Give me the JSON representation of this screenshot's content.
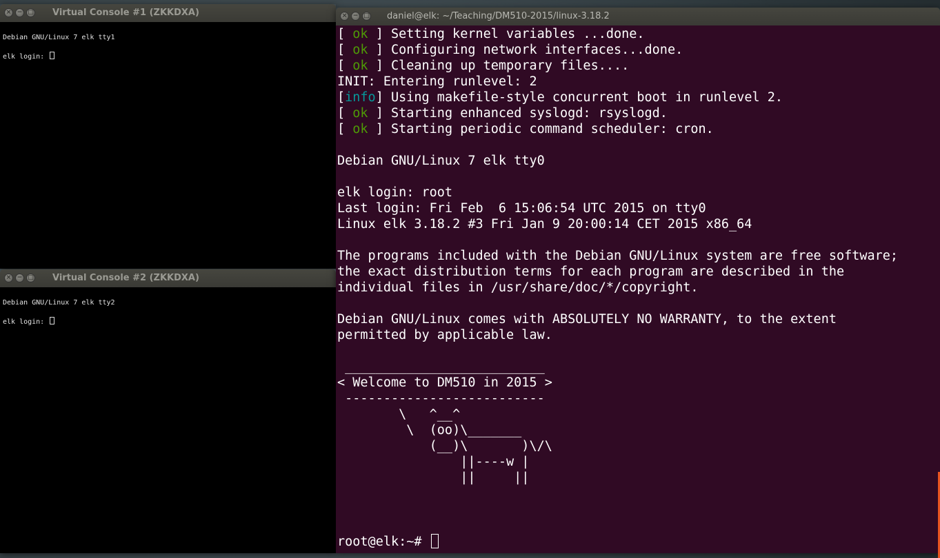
{
  "console1": {
    "title": "Virtual Console #1 (ZKKDXA)",
    "lines": [
      "Debian GNU/Linux 7 elk tty1",
      "elk login: "
    ]
  },
  "console2": {
    "title": "Virtual Console #2 (ZKKDXA)",
    "lines": [
      "Debian GNU/Linux 7 elk tty2",
      "elk login: "
    ]
  },
  "terminal": {
    "title": "daniel@elk: ~/Teaching/DM510-2015/linux-3.18.2",
    "boot": [
      {
        "open": "[ ",
        "status": "ok",
        "close": " ] ",
        "msg": "Setting kernel variables ...done."
      },
      {
        "open": "[ ",
        "status": "ok",
        "close": " ] ",
        "msg": "Configuring network interfaces...done."
      },
      {
        "open": "[ ",
        "status": "ok",
        "close": " ] ",
        "msg": "Cleaning up temporary files...."
      }
    ],
    "runlevel": "INIT: Entering runlevel: 2",
    "info": {
      "open": "[",
      "status": "info",
      "close": "] ",
      "msg": "Using makefile-style concurrent boot in runlevel 2."
    },
    "boot2": [
      {
        "open": "[ ",
        "status": "ok",
        "close": " ] ",
        "msg": "Starting enhanced syslogd: rsyslogd."
      },
      {
        "open": "[ ",
        "status": "ok",
        "close": " ] ",
        "msg": "Starting periodic command scheduler: cron."
      }
    ],
    "lines": [
      "Debian GNU/Linux 7 elk tty0",
      "elk login: root",
      "Last login: Fri Feb  6 15:06:54 UTC 2015 on tty0",
      "Linux elk 3.18.2 #3 Fri Jan 9 20:00:14 CET 2015 x86_64",
      "The programs included with the Debian GNU/Linux system are free software;",
      "the exact distribution terms for each program are described in the",
      "individual files in /usr/share/doc/*/copyright.",
      "Debian GNU/Linux comes with ABSOLUTELY NO WARRANTY, to the extent",
      "permitted by applicable law."
    ],
    "cowsay": [
      " __________________________",
      "< Welcome to DM510 in 2015 >",
      " --------------------------",
      "        \\   ^__^",
      "         \\  (oo)\\_______",
      "            (__)\\       )\\/\\",
      "                ||----w |",
      "                ||     ||"
    ],
    "prompt": "root@elk:~# "
  },
  "colors": {
    "ok": "#4e9a06",
    "info": "#06989a",
    "terminal_bg": "#300a24",
    "console_bg": "#000000",
    "accent": "#e95420"
  }
}
